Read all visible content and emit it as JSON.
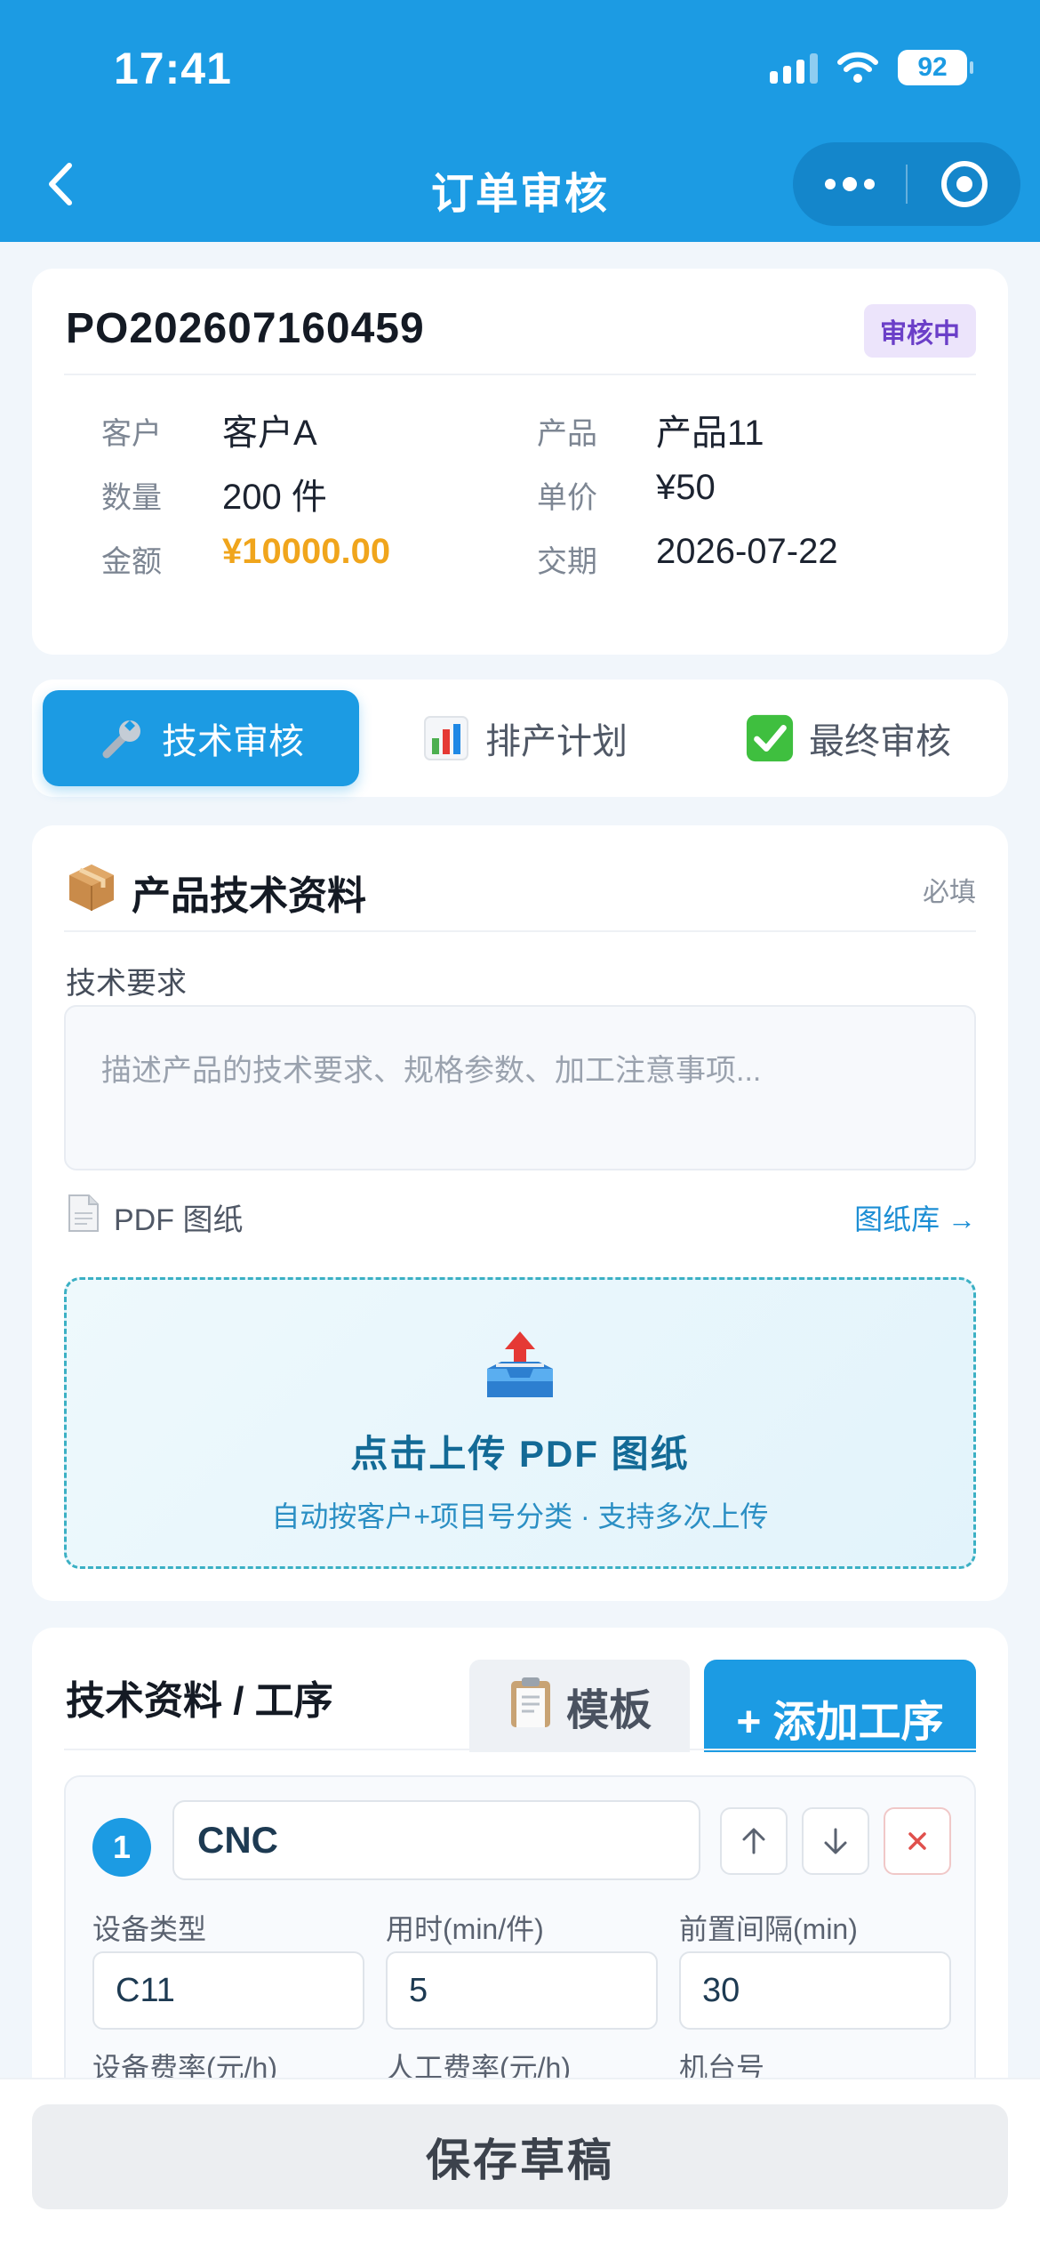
{
  "status_bar": {
    "time": "17:41",
    "battery": "92"
  },
  "nav": {
    "title": "订单审核"
  },
  "order": {
    "number": "PO202607160459",
    "status": "审核中",
    "fields": [
      {
        "label": "客户",
        "value": "客户A"
      },
      {
        "label": "产品",
        "value": "产品11"
      },
      {
        "label": "数量",
        "value": "200 件"
      },
      {
        "label": "单价",
        "value": "¥50"
      },
      {
        "label": "金额",
        "value": "¥10000.00"
      },
      {
        "label": "交期",
        "value": "2026-07-22"
      }
    ]
  },
  "tabs": [
    {
      "label": "技术审核",
      "icon": "wrench-icon",
      "active": true
    },
    {
      "label": "排产计划",
      "icon": "bar-chart-icon",
      "active": false
    },
    {
      "label": "最终审核",
      "icon": "check-box-icon",
      "active": false
    }
  ],
  "tech_section": {
    "title": "产品技术资料",
    "required": "必填",
    "requirement_label": "技术要求",
    "requirement_placeholder": "描述产品的技术要求、规格参数、加工注意事项...",
    "pdf_label": "PDF 图纸",
    "library_link": "图纸库 →",
    "upload_title": "点击上传 PDF 图纸",
    "upload_sub": "自动按客户+项目号分类 · 支持多次上传"
  },
  "process_section": {
    "title": "技术资料 / 工序",
    "template_button": "模板",
    "add_button": "+ 添加工序",
    "steps": [
      {
        "index": "1",
        "name": "CNC",
        "fields": [
          {
            "label": "设备类型",
            "value": "C11"
          },
          {
            "label": "用时(min/件)",
            "value": "5"
          },
          {
            "label": "前置间隔(min)",
            "value": "30"
          }
        ],
        "next_labels": [
          "设备费率(元/h)",
          "人工费率(元/h)",
          "机台号"
        ]
      }
    ]
  },
  "bottom": {
    "save_button": "保存草稿"
  },
  "colors": {
    "primary": "#1c9be3",
    "amount": "#f0a51c",
    "badge": "#6b3fc8"
  }
}
